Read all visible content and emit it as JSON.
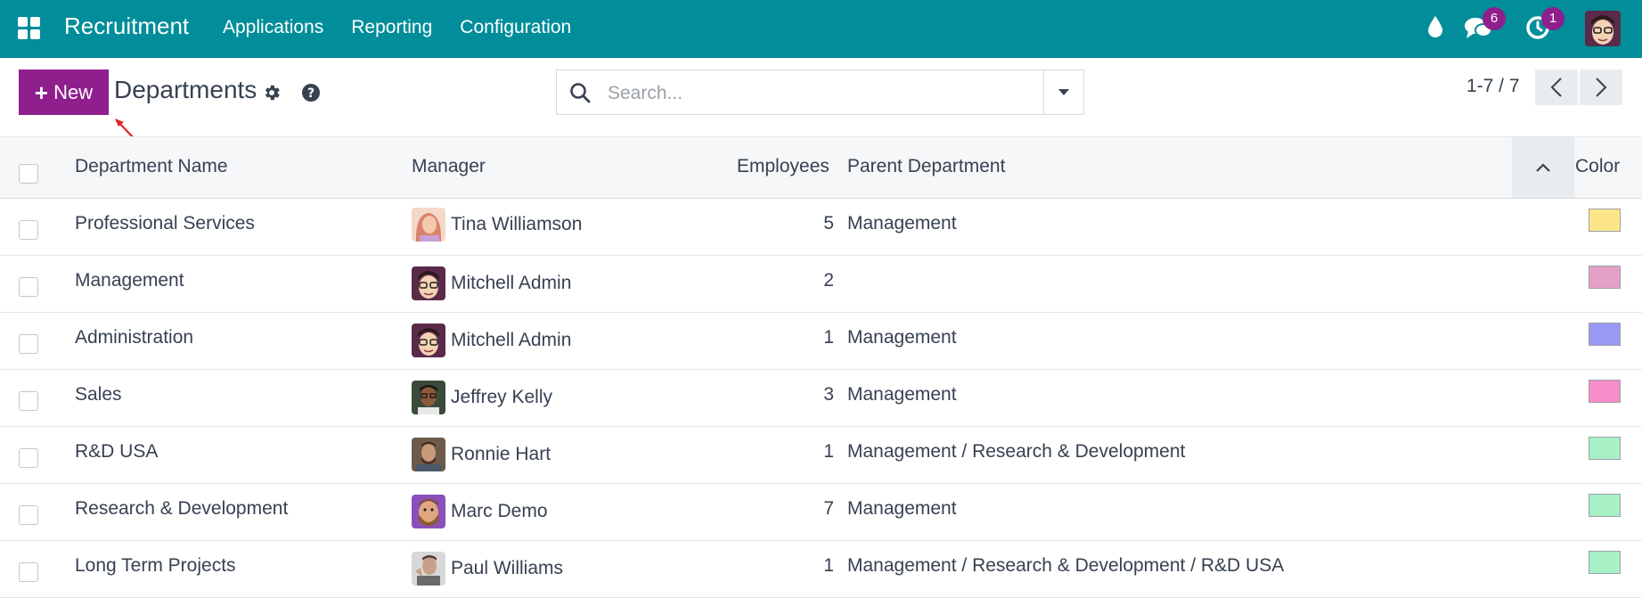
{
  "navbar": {
    "app_title": "Recruitment",
    "menu": [
      {
        "label": "Applications"
      },
      {
        "label": "Reporting"
      },
      {
        "label": "Configuration"
      }
    ],
    "messages_count": "6",
    "activities_count": "1",
    "icons": [
      "apps-grid-icon",
      "drop-icon",
      "chat-icon",
      "clock-icon",
      "user-avatar"
    ]
  },
  "control": {
    "new_label": "New",
    "page_title": "Departments",
    "search_placeholder": "Search...",
    "pager": "1-7 / 7"
  },
  "table": {
    "columns": {
      "name": "Department Name",
      "manager": "Manager",
      "employees": "Employees",
      "parent": "Parent Department",
      "color": "Color"
    },
    "rows": [
      {
        "name": "Professional Services",
        "manager": "Tina Williamson",
        "employees": "5",
        "parent": "Management",
        "color": "#fde68a"
      },
      {
        "name": "Management",
        "manager": "Mitchell Admin",
        "employees": "2",
        "parent": "",
        "color": "#e5a0c8"
      },
      {
        "name": "Administration",
        "manager": "Mitchell Admin",
        "employees": "1",
        "parent": "Management",
        "color": "#9a98f5"
      },
      {
        "name": "Sales",
        "manager": "Jeffrey Kelly",
        "employees": "3",
        "parent": "Management",
        "color": "#f78dc9"
      },
      {
        "name": "R&D USA",
        "manager": "Ronnie Hart",
        "employees": "1",
        "parent": "Management / Research & Development",
        "color": "#a8f0c6"
      },
      {
        "name": "Research & Development",
        "manager": "Marc Demo",
        "employees": "7",
        "parent": "Management",
        "color": "#a8f0c6"
      },
      {
        "name": "Long Term Projects",
        "manager": "Paul Williams",
        "employees": "1",
        "parent": "Management / Research & Development / R&D USA",
        "color": "#a8f0c6"
      }
    ]
  },
  "colors": {
    "navbar": "#018d9a",
    "primary": "#8e1f8c"
  }
}
